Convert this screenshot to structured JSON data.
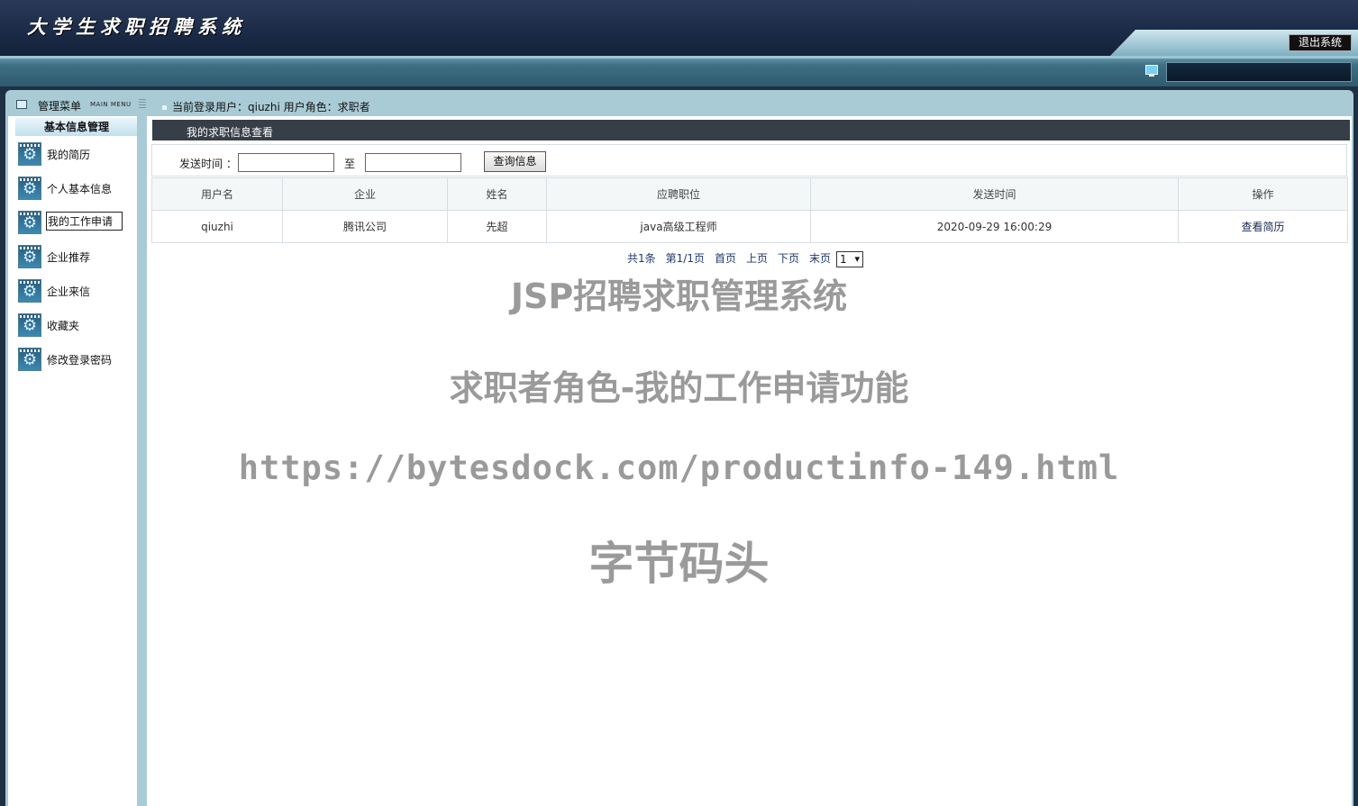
{
  "header": {
    "title": "大学生求职招聘系统",
    "logout_label": "退出系统"
  },
  "menu": {
    "title": "管理菜单",
    "subtitle": "MAIN MENU"
  },
  "user_info": "当前登录用户：qiuzhi  用户角色：求职者",
  "sidebar": {
    "section_title": "基本信息管理",
    "items": [
      {
        "label": "我的简历"
      },
      {
        "label": "个人基本信息"
      },
      {
        "label": "我的工作申请"
      },
      {
        "label": "企业推荐"
      },
      {
        "label": "企业来信"
      },
      {
        "label": "收藏夹"
      },
      {
        "label": "修改登录密码"
      }
    ]
  },
  "main": {
    "title": "我的求职信息查看",
    "search": {
      "label": "发送时间 ：",
      "to_label": "至",
      "start_value": "",
      "end_value": "",
      "button": "查询信息"
    },
    "table": {
      "headers": [
        "用户名",
        "企业",
        "姓名",
        "应聘职位",
        "发送时间",
        "操作"
      ],
      "rows": [
        {
          "username": "qiuzhi",
          "company": "腾讯公司",
          "name": "先超",
          "position": "java高级工程师",
          "sent_time": "2020-09-29 16:00:29",
          "action": "查看简历"
        }
      ]
    },
    "pager": {
      "total": "共1条",
      "page": "第1/1页",
      "first": "首页",
      "prev": "上页",
      "next": "下页",
      "last": "末页",
      "selected": "1"
    }
  },
  "watermark": {
    "line1": "JSP招聘求职管理系统",
    "line2": "求职者角色-我的工作申请功能",
    "line3": "https://bytesdock.com/productinfo-149.html",
    "line4": "字节码头"
  }
}
